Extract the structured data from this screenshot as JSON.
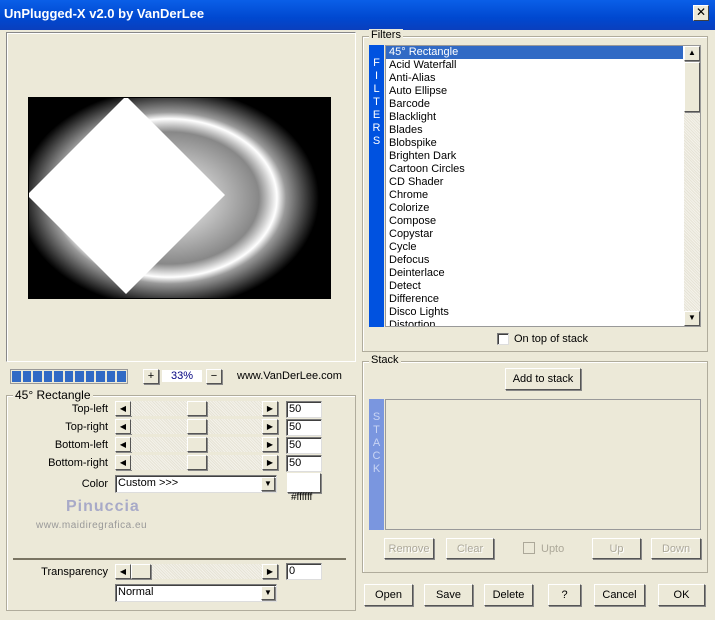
{
  "window": {
    "title": "UnPlugged-X v2.0 by VanDerLee",
    "close": "✕"
  },
  "preview": {
    "zoom": "33%",
    "plus": "+",
    "minus": "−",
    "site": "www.VanDerLee.com",
    "progress_segments": 11
  },
  "params": {
    "group": "45° Rectangle",
    "sliders": [
      {
        "label": "Top-left",
        "value": "50"
      },
      {
        "label": "Top-right",
        "value": "50"
      },
      {
        "label": "Bottom-left",
        "value": "50"
      },
      {
        "label": "Bottom-right",
        "value": "50"
      }
    ],
    "color_label": "Color",
    "color_value": "Custom >>>",
    "color_hex": "#ffffff",
    "swatch": "#ffffff",
    "watermark_name": "Pinuccia",
    "watermark_url": "www.maidiregrafica.eu",
    "transparency_label": "Transparency",
    "transparency_value": "0",
    "blend_mode": "Normal"
  },
  "filters": {
    "group": "Filters",
    "strip": "FILTERS",
    "items": [
      "45° Rectangle",
      "Acid Waterfall",
      "Anti-Alias",
      "Auto Ellipse",
      "Barcode",
      "Blacklight",
      "Blades",
      "Blobspike",
      "Brighten Dark",
      "Cartoon Circles",
      "CD Shader",
      "Chrome",
      "Colorize",
      "Compose",
      "Copystar",
      "Cycle",
      "Defocus",
      "Deinterlace",
      "Detect",
      "Difference",
      "Disco Lights",
      "Distortion"
    ],
    "selected": 0,
    "on_top_label": "On top of stack"
  },
  "stack": {
    "group": "Stack",
    "add": "Add to stack",
    "strip": "STACK",
    "remove": "Remove",
    "clear": "Clear",
    "upto": "Upto",
    "up": "Up",
    "down": "Down"
  },
  "footer": {
    "open": "Open",
    "save": "Save",
    "delete": "Delete",
    "help": "?",
    "cancel": "Cancel",
    "ok": "OK"
  },
  "colors": {
    "accent": "#316ac5",
    "strip": "#0052e0"
  }
}
